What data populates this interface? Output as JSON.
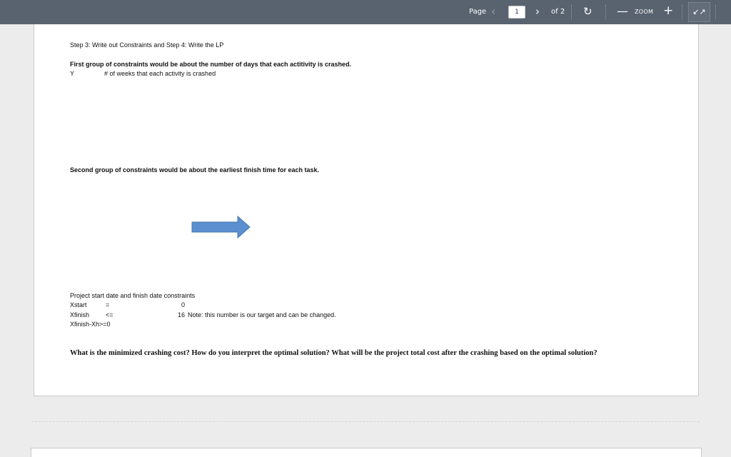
{
  "toolbar": {
    "page_label": "Page",
    "prev_icon": "‹",
    "current_page": "1",
    "next_icon": "›",
    "of_label": "of 2",
    "rotate_icon": "↻",
    "zoom_out_icon": "—",
    "zoom_label": "ZOOM",
    "zoom_in_icon": "+",
    "collapse_icon": "↙↗"
  },
  "document": {
    "step_title": "Step 3: Write out Constraints and Step 4: Write the LP",
    "group1_heading": "First group of constraints would be about the number of days that each actitivity is crashed.",
    "y_label": "Y",
    "y_desc": "# of weeks that each activity is crashed",
    "group2_heading": "Second group of constraints would be about the earliest finish time for each task.",
    "arrow_color": "#5b8fcf",
    "project_heading": "Project start date and finish date constraints",
    "constraints": [
      {
        "var": "Xstart",
        "op": "=",
        "value": "0",
        "note": ""
      },
      {
        "var": "Xfinish",
        "op": "<=",
        "value": "16",
        "note": "Note: this number is our target and can be changed."
      },
      {
        "var": "Xfinish-Xh>=0",
        "op": "",
        "value": "",
        "note": ""
      }
    ],
    "question": "What is the minimized crashing cost? How do you interpret the optimal solution? What will be the project total cost after the crashing based on the optimal solution?"
  },
  "colors": {
    "toolbar_bg": "#596370",
    "page_bg": "#ffffff",
    "viewer_bg": "#ececec"
  }
}
